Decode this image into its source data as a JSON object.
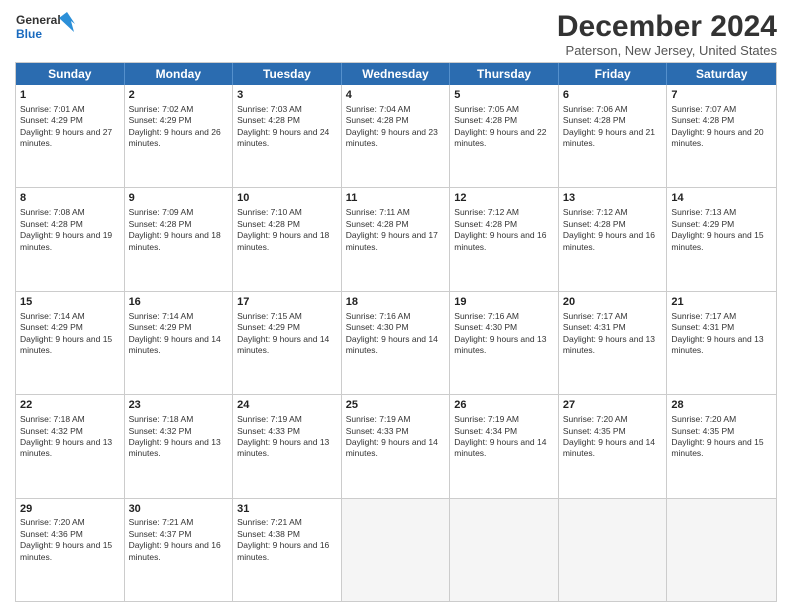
{
  "logo": {
    "line1": "General",
    "line2": "Blue"
  },
  "title": "December 2024",
  "subtitle": "Paterson, New Jersey, United States",
  "days": [
    "Sunday",
    "Monday",
    "Tuesday",
    "Wednesday",
    "Thursday",
    "Friday",
    "Saturday"
  ],
  "weeks": [
    [
      {
        "day": "1",
        "sunrise": "7:01 AM",
        "sunset": "4:29 PM",
        "daylight": "9 hours and 27 minutes."
      },
      {
        "day": "2",
        "sunrise": "7:02 AM",
        "sunset": "4:29 PM",
        "daylight": "9 hours and 26 minutes."
      },
      {
        "day": "3",
        "sunrise": "7:03 AM",
        "sunset": "4:28 PM",
        "daylight": "9 hours and 24 minutes."
      },
      {
        "day": "4",
        "sunrise": "7:04 AM",
        "sunset": "4:28 PM",
        "daylight": "9 hours and 23 minutes."
      },
      {
        "day": "5",
        "sunrise": "7:05 AM",
        "sunset": "4:28 PM",
        "daylight": "9 hours and 22 minutes."
      },
      {
        "day": "6",
        "sunrise": "7:06 AM",
        "sunset": "4:28 PM",
        "daylight": "9 hours and 21 minutes."
      },
      {
        "day": "7",
        "sunrise": "7:07 AM",
        "sunset": "4:28 PM",
        "daylight": "9 hours and 20 minutes."
      }
    ],
    [
      {
        "day": "8",
        "sunrise": "7:08 AM",
        "sunset": "4:28 PM",
        "daylight": "9 hours and 19 minutes."
      },
      {
        "day": "9",
        "sunrise": "7:09 AM",
        "sunset": "4:28 PM",
        "daylight": "9 hours and 18 minutes."
      },
      {
        "day": "10",
        "sunrise": "7:10 AM",
        "sunset": "4:28 PM",
        "daylight": "9 hours and 18 minutes."
      },
      {
        "day": "11",
        "sunrise": "7:11 AM",
        "sunset": "4:28 PM",
        "daylight": "9 hours and 17 minutes."
      },
      {
        "day": "12",
        "sunrise": "7:12 AM",
        "sunset": "4:28 PM",
        "daylight": "9 hours and 16 minutes."
      },
      {
        "day": "13",
        "sunrise": "7:12 AM",
        "sunset": "4:28 PM",
        "daylight": "9 hours and 16 minutes."
      },
      {
        "day": "14",
        "sunrise": "7:13 AM",
        "sunset": "4:29 PM",
        "daylight": "9 hours and 15 minutes."
      }
    ],
    [
      {
        "day": "15",
        "sunrise": "7:14 AM",
        "sunset": "4:29 PM",
        "daylight": "9 hours and 15 minutes."
      },
      {
        "day": "16",
        "sunrise": "7:14 AM",
        "sunset": "4:29 PM",
        "daylight": "9 hours and 14 minutes."
      },
      {
        "day": "17",
        "sunrise": "7:15 AM",
        "sunset": "4:29 PM",
        "daylight": "9 hours and 14 minutes."
      },
      {
        "day": "18",
        "sunrise": "7:16 AM",
        "sunset": "4:30 PM",
        "daylight": "9 hours and 14 minutes."
      },
      {
        "day": "19",
        "sunrise": "7:16 AM",
        "sunset": "4:30 PM",
        "daylight": "9 hours and 13 minutes."
      },
      {
        "day": "20",
        "sunrise": "7:17 AM",
        "sunset": "4:31 PM",
        "daylight": "9 hours and 13 minutes."
      },
      {
        "day": "21",
        "sunrise": "7:17 AM",
        "sunset": "4:31 PM",
        "daylight": "9 hours and 13 minutes."
      }
    ],
    [
      {
        "day": "22",
        "sunrise": "7:18 AM",
        "sunset": "4:32 PM",
        "daylight": "9 hours and 13 minutes."
      },
      {
        "day": "23",
        "sunrise": "7:18 AM",
        "sunset": "4:32 PM",
        "daylight": "9 hours and 13 minutes."
      },
      {
        "day": "24",
        "sunrise": "7:19 AM",
        "sunset": "4:33 PM",
        "daylight": "9 hours and 13 minutes."
      },
      {
        "day": "25",
        "sunrise": "7:19 AM",
        "sunset": "4:33 PM",
        "daylight": "9 hours and 14 minutes."
      },
      {
        "day": "26",
        "sunrise": "7:19 AM",
        "sunset": "4:34 PM",
        "daylight": "9 hours and 14 minutes."
      },
      {
        "day": "27",
        "sunrise": "7:20 AM",
        "sunset": "4:35 PM",
        "daylight": "9 hours and 14 minutes."
      },
      {
        "day": "28",
        "sunrise": "7:20 AM",
        "sunset": "4:35 PM",
        "daylight": "9 hours and 15 minutes."
      }
    ],
    [
      {
        "day": "29",
        "sunrise": "7:20 AM",
        "sunset": "4:36 PM",
        "daylight": "9 hours and 15 minutes."
      },
      {
        "day": "30",
        "sunrise": "7:21 AM",
        "sunset": "4:37 PM",
        "daylight": "9 hours and 16 minutes."
      },
      {
        "day": "31",
        "sunrise": "7:21 AM",
        "sunset": "4:38 PM",
        "daylight": "9 hours and 16 minutes."
      },
      null,
      null,
      null,
      null
    ]
  ],
  "labels": {
    "sunrise": "Sunrise:",
    "sunset": "Sunset:",
    "daylight": "Daylight:"
  }
}
